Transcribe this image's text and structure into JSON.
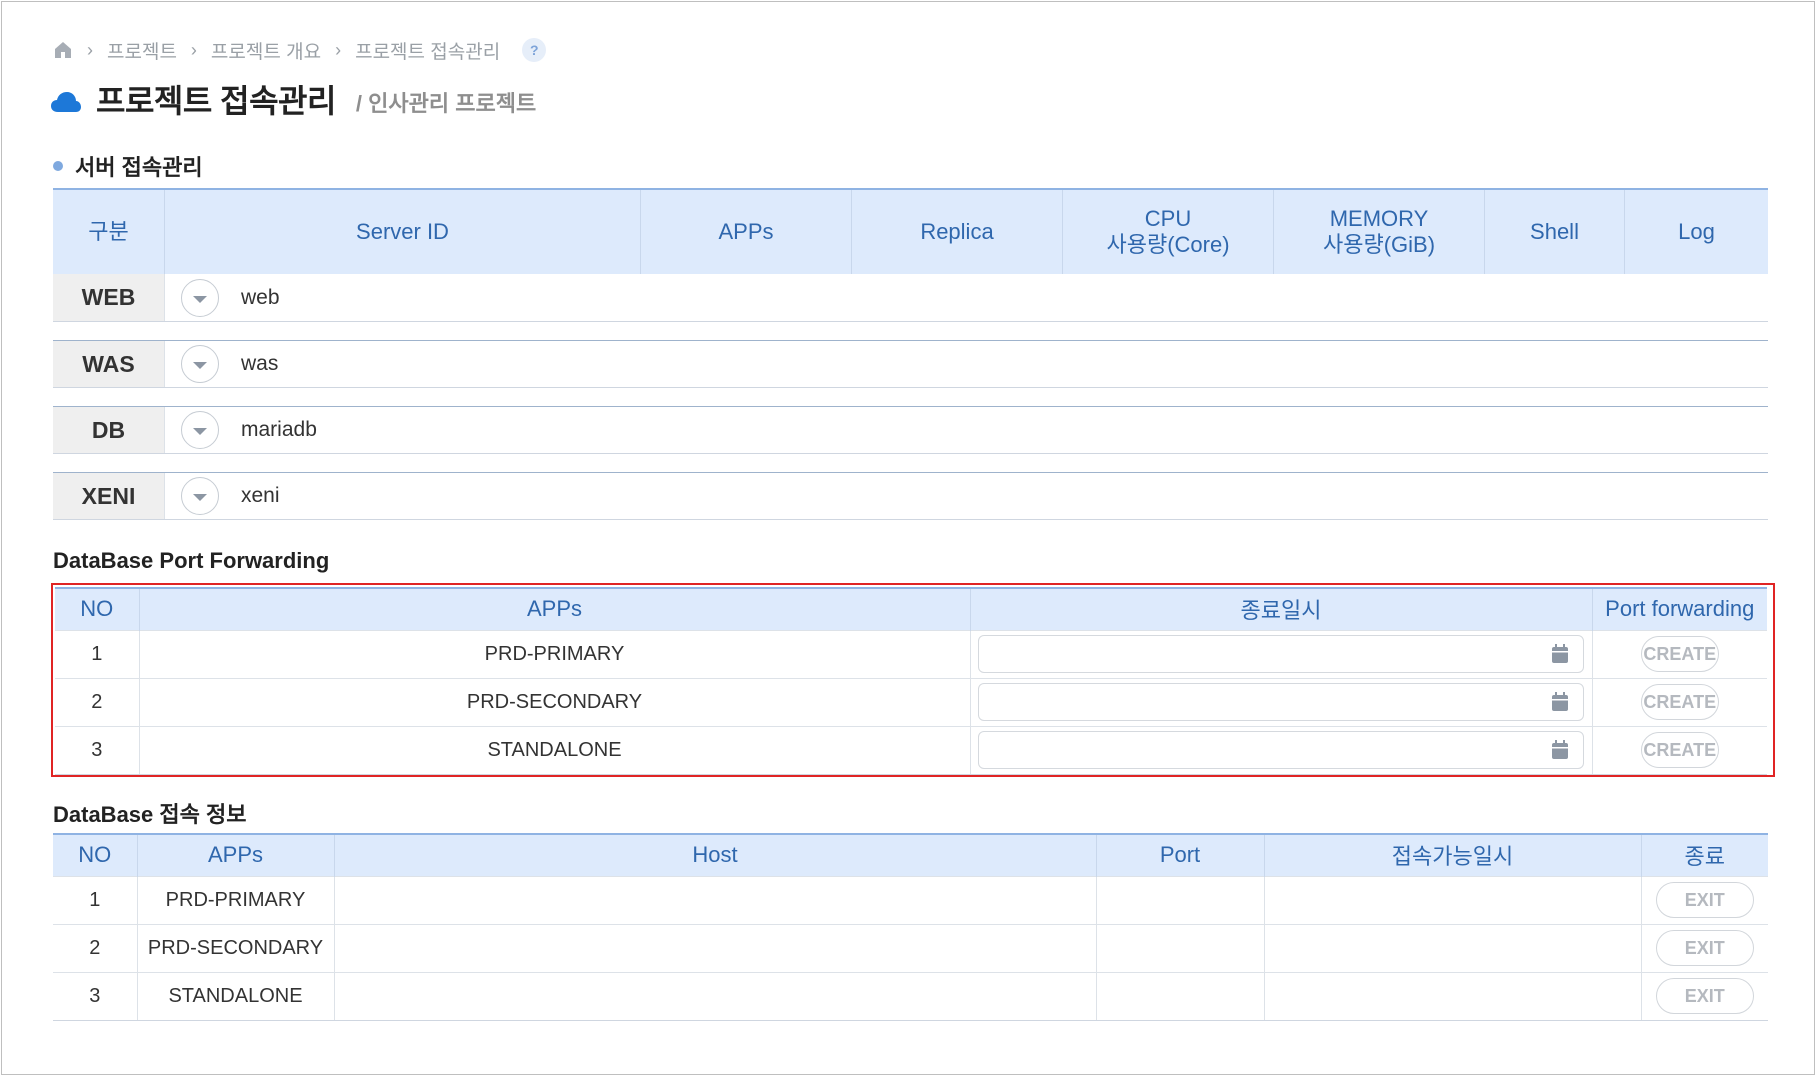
{
  "breadcrumb": {
    "items": [
      "프로젝트",
      "프로젝트 개요",
      "프로젝트 접속관리"
    ],
    "help": "?"
  },
  "page": {
    "title": "프로젝트 접속관리",
    "subtitle": "/ 인사관리 프로젝트"
  },
  "server_section": {
    "title": "서버 접속관리",
    "headers": {
      "gubun": "구분",
      "server_id": "Server ID",
      "apps": "APPs",
      "replica": "Replica",
      "cpu_1": "CPU",
      "cpu_2": "사용량(Core)",
      "mem_1": "MEMORY",
      "mem_2": "사용량(GiB)",
      "shell": "Shell",
      "log": "Log"
    },
    "rows": [
      {
        "type": "WEB",
        "name": "web"
      },
      {
        "type": "WAS",
        "name": "was"
      },
      {
        "type": "DB",
        "name": "mariadb"
      },
      {
        "type": "XENI",
        "name": "xeni"
      }
    ]
  },
  "port_forwarding": {
    "title": "DataBase Port Forwarding",
    "headers": {
      "no": "NO",
      "apps": "APPs",
      "end_time": "종료일시",
      "port_forwarding": "Port forwarding"
    },
    "rows": [
      {
        "no": "1",
        "app": "PRD-PRIMARY",
        "end_time": "",
        "action": "CREATE"
      },
      {
        "no": "2",
        "app": "PRD-SECONDARY",
        "end_time": "",
        "action": "CREATE"
      },
      {
        "no": "3",
        "app": "STANDALONE",
        "end_time": "",
        "action": "CREATE"
      }
    ]
  },
  "conn_info": {
    "title": "DataBase 접속 정보",
    "headers": {
      "no": "NO",
      "apps": "APPs",
      "host": "Host",
      "port": "Port",
      "available": "접속가능일시",
      "end": "종료"
    },
    "rows": [
      {
        "no": "1",
        "app": "PRD-PRIMARY",
        "host": "",
        "port": "",
        "available": "",
        "action": "EXIT"
      },
      {
        "no": "2",
        "app": "PRD-SECONDARY",
        "host": "",
        "port": "",
        "available": "",
        "action": "EXIT"
      },
      {
        "no": "3",
        "app": "STANDALONE",
        "host": "",
        "port": "",
        "available": "",
        "action": "EXIT"
      }
    ]
  },
  "colors": {
    "accent": "#2f67ad",
    "header_bg": "#ddeafc",
    "highlight_border": "#e02424"
  }
}
